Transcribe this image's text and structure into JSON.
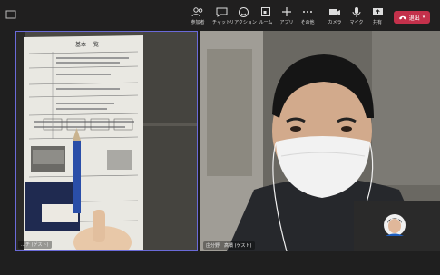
{
  "toolbar": {
    "participants_label": "参加者",
    "chat_label": "チャット",
    "reactions_label": "リアクション",
    "rooms_label": "ルーム",
    "apps_label": "アプリ",
    "more_label": "その他",
    "camera_label": "カメラ",
    "mic_label": "マイク",
    "share_label": "共有",
    "leave_label": "退出"
  },
  "tiles": {
    "left_name": "…チ (ゲスト)",
    "right_name": "庄分野　高橋 (ゲスト)",
    "doc_heading": "基本 一覧"
  },
  "colors": {
    "leave": "#c4314b",
    "active_border": "#6a6ad8"
  }
}
